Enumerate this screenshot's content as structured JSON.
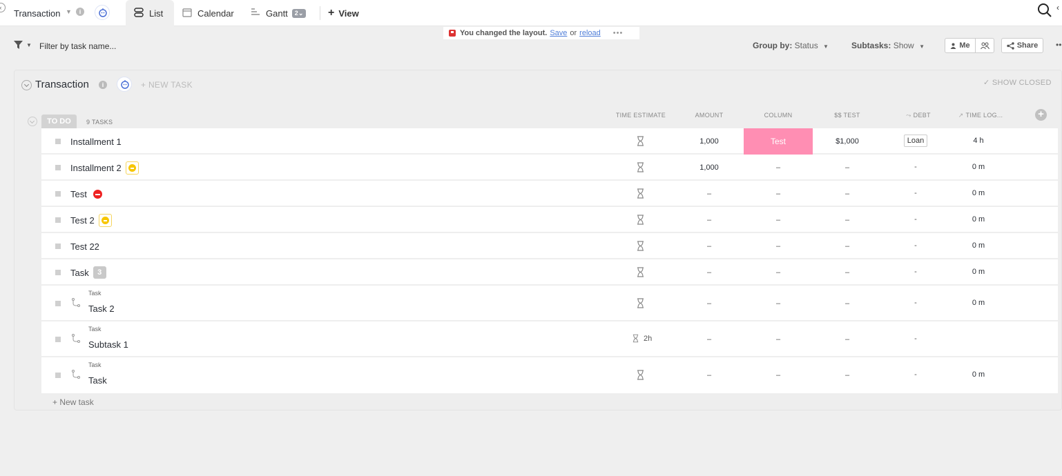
{
  "topbar": {
    "workspace_title": "Transaction",
    "tabs": [
      {
        "label": "List",
        "active": true
      },
      {
        "label": "Calendar",
        "active": false
      },
      {
        "label": "Gantt",
        "active": false,
        "badge": "2"
      }
    ],
    "add_view_label": "View"
  },
  "notice": {
    "message": "You changed the layout.",
    "save_label": "Save",
    "or_label": "or",
    "reload_label": "reload",
    "more": "•••"
  },
  "toolbar": {
    "filter_placeholder": "Filter by task name...",
    "group_by_label": "Group by:",
    "group_by_value": "Status",
    "subtasks_label": "Subtasks:",
    "subtasks_value": "Show",
    "me_label": "Me",
    "share_label": "Share"
  },
  "list": {
    "title": "Transaction",
    "new_task_label": "+ NEW TASK",
    "show_closed_label": "✓ SHOW CLOSED",
    "new_task_bottom": "+ New task"
  },
  "group": {
    "status": "TO DO",
    "count_label": "9 TASKS",
    "columns": {
      "time_estimate": "TIME ESTIMATE",
      "amount": "AMOUNT",
      "column": "COLUMN",
      "test": "$$ TEST",
      "debt": "DEBT",
      "time_log": "TIME LOG..."
    }
  },
  "tasks": [
    {
      "name": "Installment 1",
      "badge": "",
      "time_estimate": "",
      "amount": "1,000",
      "column": "Test",
      "test": "$1,000",
      "debt": "Loan",
      "time_log": "4 h"
    },
    {
      "name": "Installment 2",
      "badge": "yellow",
      "time_estimate": "",
      "amount": "1,000",
      "column": "–",
      "test": "–",
      "debt": "-",
      "time_log": "0 m"
    },
    {
      "name": "Test",
      "badge": "red",
      "time_estimate": "",
      "amount": "–",
      "column": "–",
      "test": "–",
      "debt": "-",
      "time_log": "0 m"
    },
    {
      "name": "Test 2",
      "badge": "yellow",
      "time_estimate": "",
      "amount": "–",
      "column": "–",
      "test": "–",
      "debt": "-",
      "time_log": "0 m"
    },
    {
      "name": "Test 22",
      "badge": "",
      "time_estimate": "",
      "amount": "–",
      "column": "–",
      "test": "–",
      "debt": "-",
      "time_log": "0 m"
    },
    {
      "name": "Task",
      "badge": "3",
      "time_estimate": "",
      "amount": "–",
      "column": "–",
      "test": "–",
      "debt": "-",
      "time_log": "0 m"
    },
    {
      "name": "Task 2",
      "parent": "Task",
      "time_estimate": "",
      "amount": "–",
      "column": "–",
      "test": "–",
      "debt": "-",
      "time_log": "0 m"
    },
    {
      "name": "Subtask 1",
      "parent": "Task",
      "time_estimate": "2h",
      "amount": "–",
      "column": "–",
      "test": "–",
      "debt": "-",
      "time_log": ""
    },
    {
      "name": "Task",
      "parent": "Task",
      "time_estimate": "",
      "amount": "–",
      "column": "–",
      "test": "–",
      "debt": "-",
      "time_log": "0 m"
    }
  ],
  "colors": {
    "column_test_bg": "#ff8eb3",
    "status_pill": "#d3d3d3",
    "link": "#4f7ed8"
  }
}
